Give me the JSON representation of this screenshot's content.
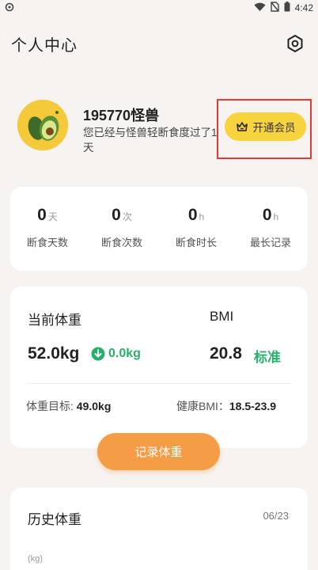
{
  "status_bar": {
    "time": "4:42",
    "icons": [
      "settings-dot-icon",
      "wifi-icon",
      "no-sim-icon",
      "battery-icon"
    ]
  },
  "header": {
    "title": "个人中心",
    "settings_icon": "hexagon-settings-icon"
  },
  "profile": {
    "username": "195770怪兽",
    "subtext": "您已经与怪兽轻断食度过了1天",
    "vip_button_label": "开通会员",
    "vip_icon": "crown-icon",
    "avatar_icon": "avocado-icon"
  },
  "stats": [
    {
      "value": "0",
      "unit": "天",
      "label": "断食天数"
    },
    {
      "value": "0",
      "unit": "次",
      "label": "断食次数"
    },
    {
      "value": "0",
      "unit": "h",
      "label": "断食时长"
    },
    {
      "value": "0",
      "unit": "h",
      "label": "最长记录"
    }
  ],
  "weight": {
    "current_label": "当前体重",
    "current_value": "52.0kg",
    "delta_value": "0.0kg",
    "delta_icon": "down-arrow-circle-icon",
    "bmi_label": "BMI",
    "bmi_value": "20.8",
    "bmi_status": "标准",
    "target_label": "体重目标:",
    "target_value": "49.0kg",
    "healthy_bmi_label": "健康BMI：",
    "healthy_bmi_value": "18.5-23.9"
  },
  "record_button_label": "记录体重",
  "history": {
    "title": "历史体重",
    "date": "06/23",
    "unit_label": "(kg)"
  },
  "colors": {
    "background": "#f6f3f1",
    "vip_yellow": "#f7d43d",
    "accent_orange": "#f59c46",
    "status_green": "#27b06a",
    "highlight_red": "#e53935"
  }
}
